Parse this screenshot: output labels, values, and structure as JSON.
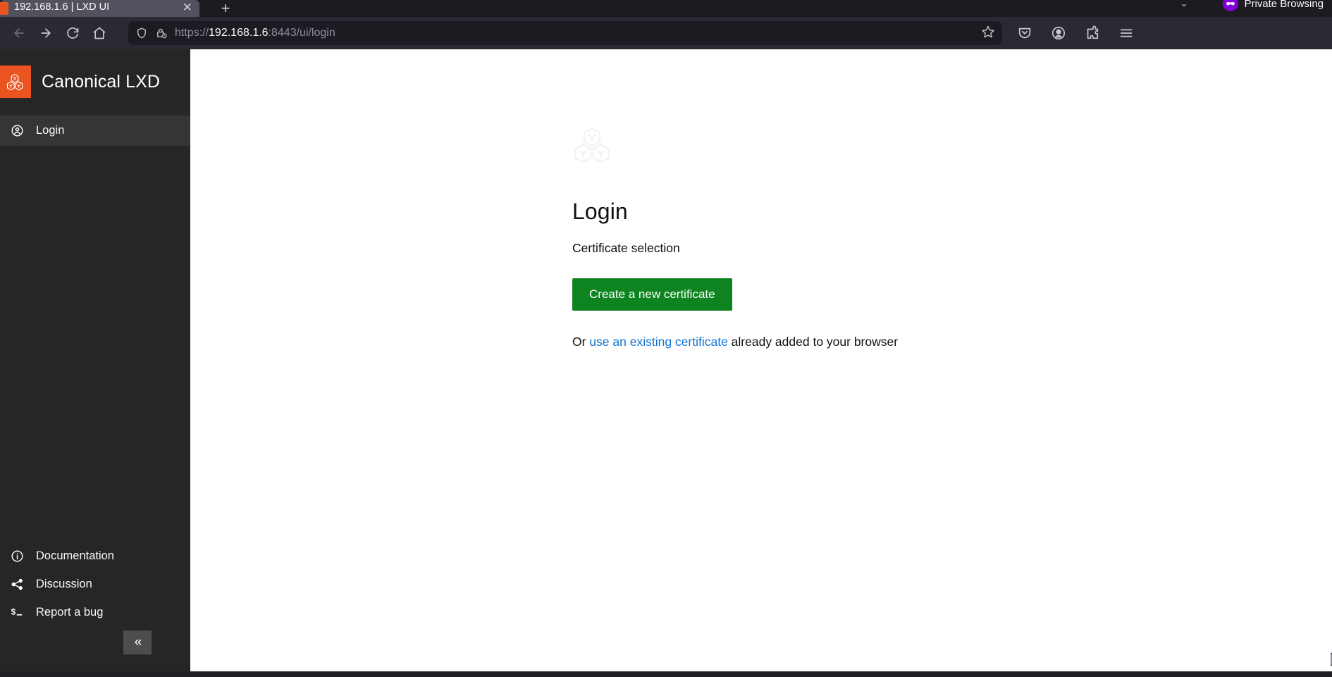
{
  "browser": {
    "tab": {
      "title": "192.168.1.6 | LXD UI",
      "favicon": "lxd-favicon",
      "close_label": "✕"
    },
    "new_tab_label": "+",
    "private_browsing": {
      "label": "Private Browsing",
      "chevron": "⌄",
      "mask_icon": "private-mask-icon",
      "color": "#8000d7"
    },
    "nav": {
      "back_icon": "arrow-left-icon",
      "forward_icon": "arrow-right-icon",
      "reload_icon": "reload-icon",
      "home_icon": "home-icon"
    },
    "url": {
      "shield_icon": "tracking-shield-icon",
      "lock_icon": "insecure-lock-warning-icon",
      "scheme": "https://",
      "host": "192.168.1.6",
      "rest": ":8443/ui/login",
      "full": "https://192.168.1.6:8443/ui/login",
      "bookmark_icon": "star-icon"
    },
    "toolbar_icons": [
      {
        "name": "pocket-icon"
      },
      {
        "name": "account-icon"
      },
      {
        "name": "extensions-puzzle-icon"
      },
      {
        "name": "app-menu-icon"
      }
    ]
  },
  "sidebar": {
    "brand": {
      "logo_icon": "lxd-cube-logo-icon",
      "name": "Canonical LXD",
      "logo_color": "#e95420"
    },
    "nav_items": [
      {
        "label": "Login",
        "icon": "user-circle-icon",
        "active": true
      }
    ],
    "footer_items": [
      {
        "label": "Documentation",
        "icon": "info-circle-icon"
      },
      {
        "label": "Discussion",
        "icon": "share-nodes-icon"
      },
      {
        "label": "Report a bug",
        "icon": "terminal-prompt-icon"
      }
    ],
    "collapse_button": {
      "label": "«",
      "name": "collapse-sidebar-button"
    }
  },
  "main": {
    "logo_icon": "lxd-hex-cluster-icon",
    "title": "Login",
    "subtitle": "Certificate selection",
    "primary_button": {
      "label": "Create a new certificate",
      "color": "#0e8420"
    },
    "or_prefix": "Or ",
    "or_link": "use an existing certificate",
    "or_suffix": " already added to your browser",
    "link_color": "#0f74d6"
  }
}
